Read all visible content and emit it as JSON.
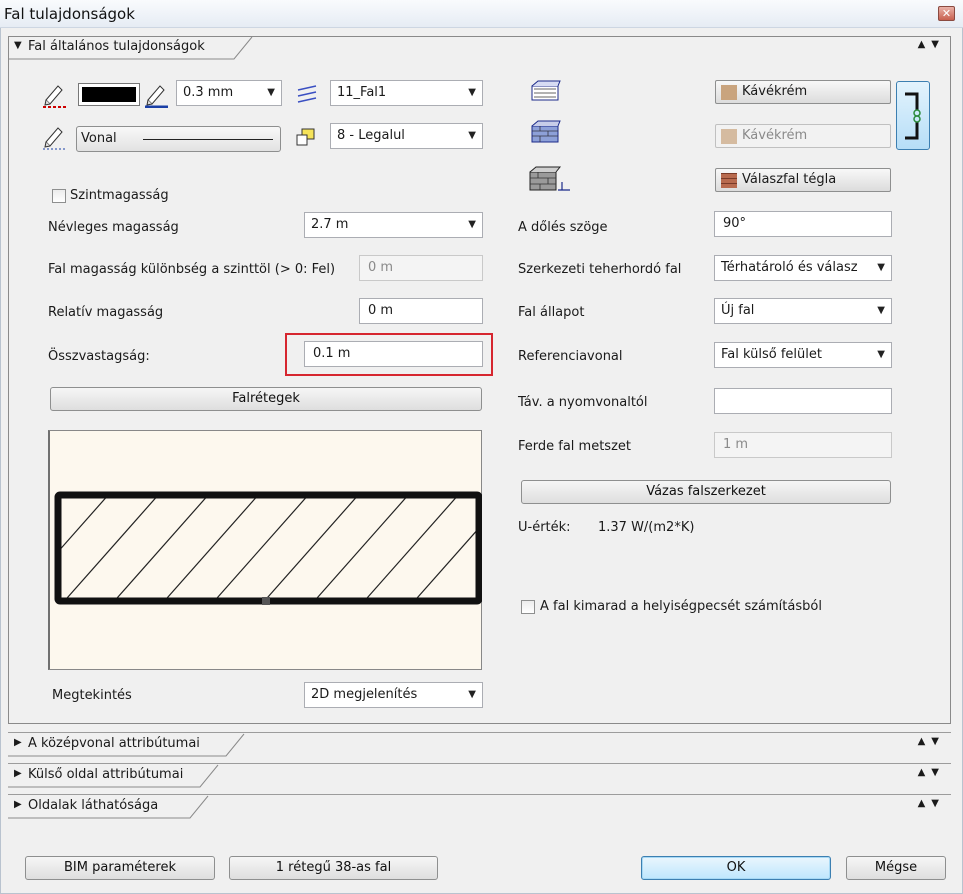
{
  "window": {
    "title": "Fal tulajdonságok"
  },
  "sections": {
    "main": "Fal általános tulajdonságok",
    "centerline": "A középvonal attribútumai",
    "outer": "Külső oldal attribútumai",
    "visibility": "Oldalak láthatósága"
  },
  "pen": {
    "thickness": "0.3 mm",
    "layer": "11_Fal1",
    "line_type": "Vonal",
    "priority": "8 - Legalul"
  },
  "materials": {
    "top": "Kávékrém",
    "side": "Kávékrém",
    "section": "Válaszfal tégla"
  },
  "left_form": {
    "level_height_checkbox": "Szintmagasság",
    "nominal_height_label": "Névleges magasság",
    "nominal_height_value": "2.7 m",
    "height_diff_label": "Fal magasság különbség a szinttöl (> 0: Fel)",
    "height_diff_value": "0 m",
    "relative_height_label": "Relatív magasság",
    "relative_height_value": "0 m",
    "total_thickness_label": "Összvastagság:",
    "total_thickness_value": "0.1 m",
    "layers_button": "Falrétegek",
    "view_label": "Megtekintés",
    "view_value": "2D megjelenítés"
  },
  "right_form": {
    "tilt_label": "A dőlés szöge",
    "tilt_value": "90°",
    "structural_label": "Szerkezeti teherhordó fal",
    "structural_value": "Térhatároló és válasz",
    "state_label": "Fal állapot",
    "state_value": "Új fal",
    "reference_label": "Referenciavonal",
    "reference_value": "Fal külső felület",
    "distance_label": "Táv. a nyomvonaltól",
    "distance_value": "",
    "oblique_label": "Ferde fal metszet",
    "oblique_value": "1 m",
    "frame_button": "Vázas falszerkezet",
    "u_value_label": "U-érték:",
    "u_value": "1.37 W/(m2*K)",
    "exclude_checkbox": "A fal kimarad a helyiségpecsét számításból"
  },
  "footer": {
    "bim_button": "BIM paraméterek",
    "wall_type_button": "1 rétegű 38-as fal",
    "ok_button": "OK",
    "cancel_button": "Mégse"
  },
  "colors": {
    "coffee_cream": "#c9a47e",
    "brick": "#b86a4e",
    "highlight": "#d6262f"
  }
}
